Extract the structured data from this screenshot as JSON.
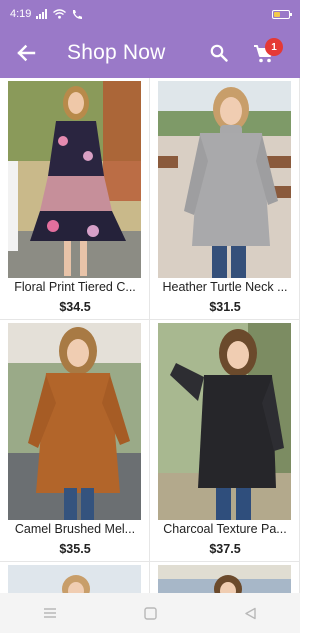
{
  "status_bar": {
    "time": "4:19",
    "battery_level": 0.4
  },
  "app_bar": {
    "title": "Shop Now",
    "cart_count": "1"
  },
  "products": [
    {
      "name": "Floral Print Tiered C...",
      "price": "$34.5"
    },
    {
      "name": "Heather Turtle Neck ...",
      "price": "$31.5"
    },
    {
      "name": "Camel Brushed Mel...",
      "price": "$35.5"
    },
    {
      "name": "Charcoal Texture Pa...",
      "price": "$37.5"
    }
  ],
  "colors": {
    "primary": "#9a79c8",
    "badge": "#e53935"
  },
  "icons": [
    "back-arrow-icon",
    "search-icon",
    "cart-icon",
    "menu-icon",
    "home-square-icon",
    "back-triangle-icon"
  ]
}
